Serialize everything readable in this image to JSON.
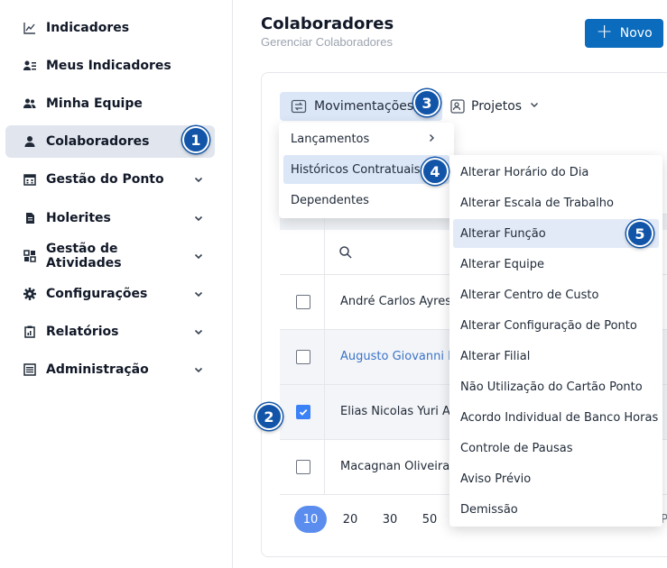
{
  "sidebar": {
    "items": [
      {
        "label": "Indicadores",
        "icon": "chart-line-icon",
        "chevron": false
      },
      {
        "label": "Meus Indicadores",
        "icon": "user-list-icon",
        "chevron": false
      },
      {
        "label": "Minha Equipe",
        "icon": "users-icon",
        "chevron": false
      },
      {
        "label": "Colaboradores",
        "icon": "user-icon",
        "chevron": false,
        "active": true
      },
      {
        "label": "Gestão do Ponto",
        "icon": "calendar-icon",
        "chevron": true
      },
      {
        "label": "Holerites",
        "icon": "document-icon",
        "chevron": true
      },
      {
        "label": "Gestão de Atividades",
        "icon": "grid-icon",
        "chevron": true
      },
      {
        "label": "Configurações",
        "icon": "gear-icon",
        "chevron": true
      },
      {
        "label": "Relatórios",
        "icon": "clipboard-icon",
        "chevron": true
      },
      {
        "label": "Administração",
        "icon": "sliders-icon",
        "chevron": true
      }
    ]
  },
  "header": {
    "title": "Colaboradores",
    "subtitle": "Gerenciar Colaboradores",
    "new_button": "Novo"
  },
  "toolbar": {
    "movimentacoes": "Movimentações",
    "projetos": "Projetos"
  },
  "table": {
    "rows": [
      {
        "name": "André Carlos Ayres",
        "checked": false,
        "link": false
      },
      {
        "name": "Augusto Giovanni Po",
        "checked": false,
        "link": true
      },
      {
        "name": "Elias Nicolas Yuri Alm",
        "checked": true,
        "link": false
      },
      {
        "name": "Macagnan Oliveira",
        "checked": false,
        "link": false
      }
    ]
  },
  "pagination": {
    "sizes": [
      "10",
      "20",
      "30",
      "50"
    ],
    "active": "10",
    "trailing": "P"
  },
  "menu_movimentacoes": {
    "items": [
      "Lançamentos",
      "Históricos Contratuais",
      "Dependentes"
    ]
  },
  "menu_historicos": {
    "items": [
      "Alterar Horário do Dia",
      "Alterar Escala de Trabalho",
      "Alterar Função",
      "Alterar Equipe",
      "Alterar Centro de Custo",
      "Alterar Configuração de Ponto",
      "Alterar Filial",
      "Não Utilização do Cartão Ponto",
      "Acordo Individual de Banco Horas",
      "Controle de Pausas",
      "Aviso Prévio",
      "Demissão"
    ]
  },
  "steps": [
    "1",
    "2",
    "3",
    "4",
    "5"
  ],
  "colors": {
    "primary": "#0b6bbd",
    "badge": "#1255a8",
    "highlight": "#dbe6f7",
    "active_nav": "#e1e6ee",
    "checkbox": "#3b82f6"
  }
}
